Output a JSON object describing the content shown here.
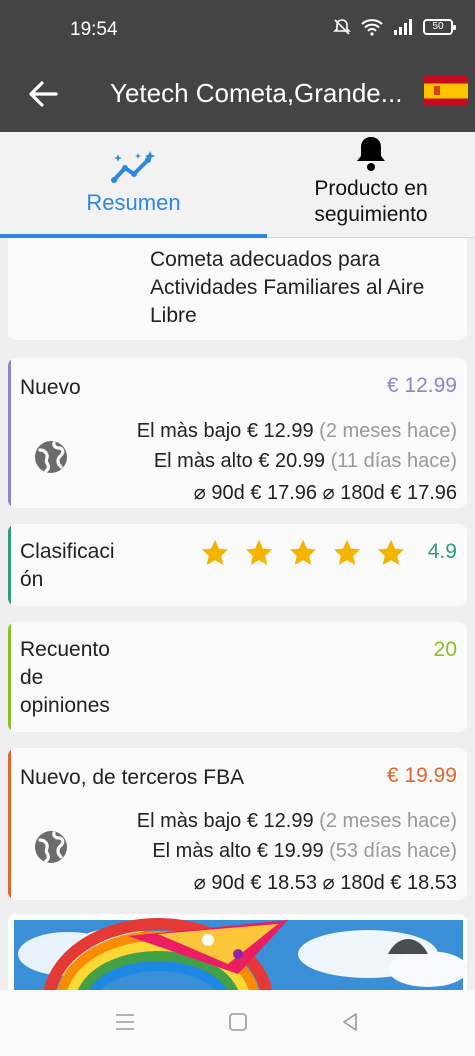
{
  "status": {
    "time": "19:54",
    "battery": "50"
  },
  "appbar": {
    "title": "Yetech Cometa,Grande..."
  },
  "tabs": [
    {
      "label": "Resumen"
    },
    {
      "label_line1": "Producto en",
      "label_line2": "seguimiento"
    }
  ],
  "description": {
    "line1": "Cometa adecuados para",
    "line2": "Actividades Familiares al Aire",
    "line3": "Libre"
  },
  "nuevo": {
    "label": "Nuevo",
    "price": "€ 12.99",
    "low_label": "El màs bajo",
    "low_value": "€ 12.99",
    "low_when": "(2 meses hace)",
    "high_label": "El màs alto",
    "high_value": "€ 20.99",
    "high_when": "(11 días hace)",
    "avg90_label": "⌀ 90d",
    "avg90_value": "€ 17.96",
    "avg180_label": "⌀ 180d",
    "avg180_value": "€ 17.96",
    "accent": "#8c86c9"
  },
  "rating": {
    "label_line1": "Clasificaci",
    "label_line2": "ón",
    "value": "4.9",
    "stars": 5,
    "accent": "#2e9c7e"
  },
  "reviews": {
    "label_line1": "Recuento",
    "label_line2": "de",
    "label_line3": "opiniones",
    "value": "20",
    "accent": "#8bbf2a"
  },
  "fba": {
    "label": "Nuevo, de terceros FBA",
    "price": "€ 19.99",
    "low_label": "El màs bajo",
    "low_value": "€ 12.99",
    "low_when": "(2 meses hace)",
    "high_label": "El màs alto",
    "high_value": "€ 19.99",
    "high_when": "(53 días hace)",
    "avg90_label": "⌀ 90d",
    "avg90_value": "€ 18.53",
    "avg180_label": "⌀ 180d",
    "avg180_value": "€ 18.53",
    "accent": "#e0662b"
  }
}
